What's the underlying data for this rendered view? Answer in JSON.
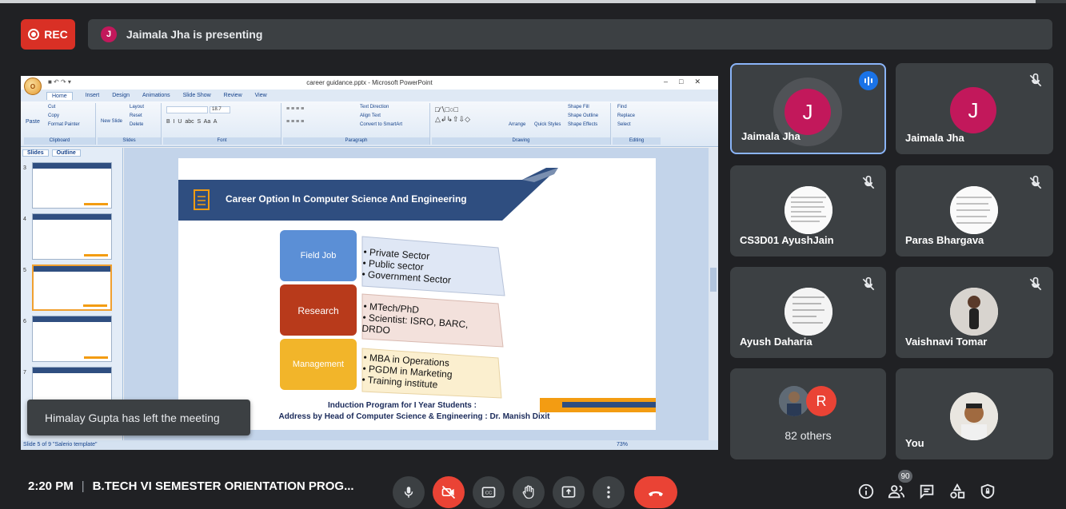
{
  "recording": {
    "label": "REC"
  },
  "presenting": {
    "avatar_letter": "J",
    "text": "Jaimala Jha is presenting"
  },
  "powerpoint": {
    "window_title": "career guidance.pptx - Microsoft PowerPoint",
    "tabs": [
      "Home",
      "Insert",
      "Design",
      "Animations",
      "Slide Show",
      "Review",
      "View"
    ],
    "ribbon": {
      "clipboard": {
        "paste": "Paste",
        "cut": "Cut",
        "copy": "Copy",
        "format_painter": "Format Painter",
        "label": "Clipboard"
      },
      "slides": {
        "new_slide": "New Slide",
        "layout": "Layout",
        "reset": "Reset",
        "delete": "Delete",
        "label": "Slides"
      },
      "font": {
        "label": "Font",
        "size": "18.7"
      },
      "paragraph": {
        "label": "Paragraph",
        "text_direction": "Text Direction",
        "align_text": "Align Text",
        "smartart": "Convert to SmartArt"
      },
      "drawing": {
        "label": "Drawing",
        "arrange": "Arrange",
        "quick_styles": "Quick Styles",
        "shape_fill": "Shape Fill",
        "shape_outline": "Shape Outline",
        "shape_effects": "Shape Effects"
      },
      "editing": {
        "label": "Editing",
        "find": "Find",
        "replace": "Replace",
        "select": "Select"
      }
    },
    "panel_tabs": [
      "Slides",
      "Outline"
    ],
    "thumb_numbers": [
      "3",
      "4",
      "5",
      "6",
      "7"
    ],
    "status_text": "Slide 5 of 9   \"Salerio template\"",
    "zoom": "73%",
    "slide": {
      "title": "Career Option In Computer Science And Engineering",
      "rows": [
        {
          "label": "Field Job",
          "items": [
            "Private Sector",
            "Public sector",
            "Government Sector"
          ],
          "color": "#5b8fd6",
          "light": "#dfe7f5"
        },
        {
          "label": "Research",
          "items": [
            "MTech/PhD",
            "Scientist: ISRO, BARC, DRDO"
          ],
          "color": "#b83a1b",
          "light": "#f3e1dc"
        },
        {
          "label": "Management",
          "items": [
            "MBA in Operations",
            "PGDM in Marketing",
            "Training institute"
          ],
          "color": "#f2b52a",
          "light": "#fbefcf"
        }
      ],
      "footer_line1": "Induction Program  for I Year Students :",
      "footer_line2": "Address by Head of Computer Science & Engineering : Dr. Manish Dixit"
    }
  },
  "toast": "Himalay Gupta has left the meeting",
  "participants": [
    {
      "name": "Jaimala Jha",
      "letter": "J",
      "speaking": true
    },
    {
      "name": "Jaimala Jha",
      "letter": "J",
      "muted": true
    },
    {
      "name": "CS3D01 AyushJain",
      "muted": true
    },
    {
      "name": "Paras Bhargava",
      "muted": true
    },
    {
      "name": "Ayush Daharia",
      "muted": true
    },
    {
      "name": "Vaishnavi Tomar",
      "muted": true
    },
    {
      "name": "82 others",
      "letter": "R"
    },
    {
      "name": "You"
    }
  ],
  "bottom": {
    "time": "2:20 PM",
    "meeting_name": "B.TECH VI SEMESTER ORIENTATION PROG...",
    "participant_count": "90"
  },
  "colors": {
    "bg": "#202124",
    "tile": "#3c4043",
    "red": "#ea4335",
    "avatar": "#c2185b",
    "active": "#8ab4f8"
  }
}
